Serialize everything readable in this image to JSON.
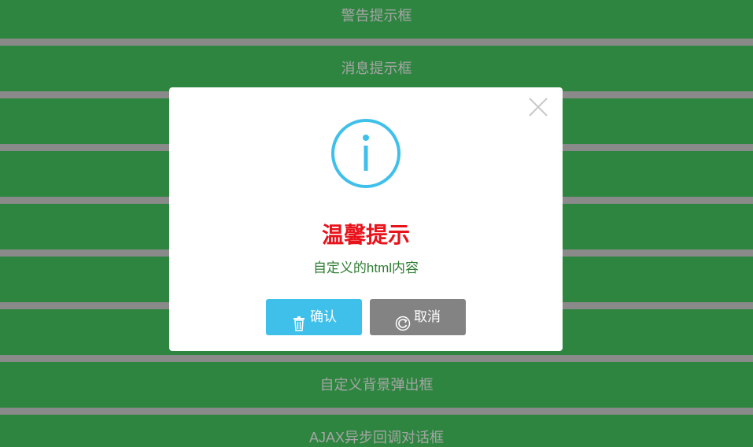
{
  "list": {
    "items": [
      {
        "label": "警告提示框"
      },
      {
        "label": "消息提示框"
      },
      {
        "label": ""
      },
      {
        "label": ""
      },
      {
        "label": ""
      },
      {
        "label": ""
      },
      {
        "label": ""
      },
      {
        "label": "自定义背景弹出框"
      },
      {
        "label": "AJAX异步回调对话框"
      }
    ]
  },
  "dialog": {
    "icon": "info-circle-icon",
    "title": "温馨提示",
    "content": "自定义的html内容",
    "confirm_label": "确认",
    "confirm_icon": "trash-icon",
    "cancel_label": "取消",
    "cancel_icon": "refresh-icon",
    "close_icon": "close-icon"
  },
  "colors": {
    "bar_background": "#2e8540",
    "bar_text": "#a5a5a5",
    "separator": "#8a8a8a",
    "title": "#e8131b",
    "content": "#2e7d32",
    "info_icon": "#3fc0ea",
    "confirm_button": "#3fc0ea",
    "cancel_button": "#838383"
  }
}
